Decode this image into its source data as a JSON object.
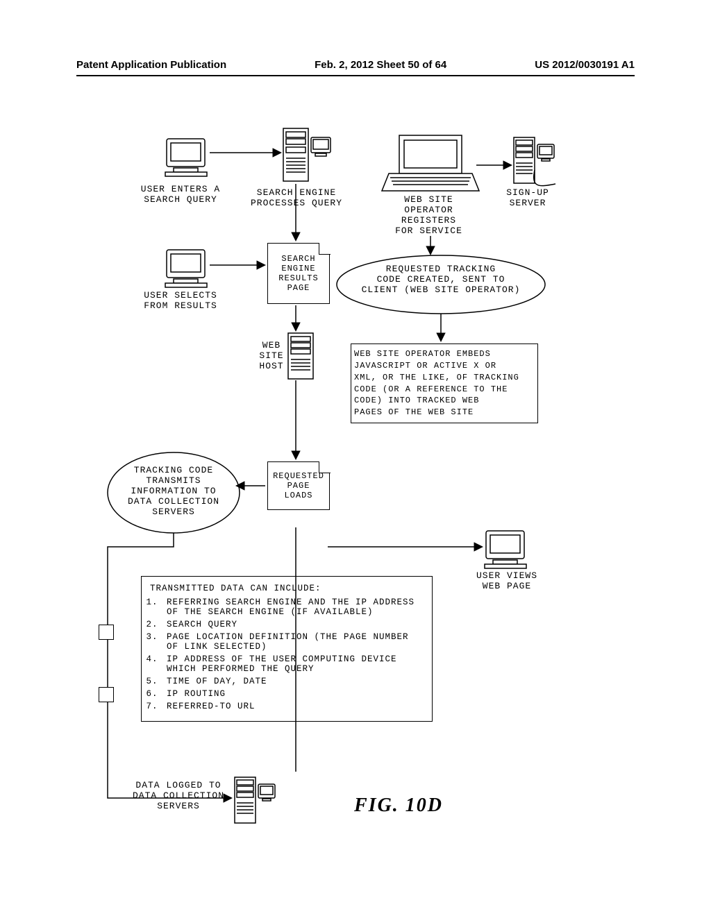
{
  "header": {
    "left": "Patent Application Publication",
    "center": "Feb. 2, 2012  Sheet 50 of 64",
    "right": "US 2012/0030191 A1"
  },
  "labels": {
    "user_enters_query": "USER ENTERS A\nSEARCH QUERY",
    "search_engine_processes": "SEARCH ENGINE\nPROCESSES QUERY",
    "website_operator_registers": "WEB SITE\nOPERATOR\nREGISTERS\nFOR SERVICE",
    "signup_server": "SIGN-UP\nSERVER",
    "user_selects_results": "USER SELECTS\nFROM RESULTS",
    "search_results_page": "SEARCH\nENGINE\nRESULTS\nPAGE",
    "tracking_code_created": "REQUESTED TRACKING\nCODE CREATED, SENT TO\nCLIENT (WEB SITE OPERATOR)",
    "website_host": "WEB\nSITE\nHOST",
    "operator_embeds": "WEB SITE OPERATOR EMBEDS\nJAVASCRIPT OR ACTIVE X OR\nXML, OR THE LIKE, OF TRACKING\nCODE (OR A REFERENCE TO THE\nCODE) INTO TRACKED WEB\nPAGES OF THE WEB SITE",
    "tracking_transmits": "TRACKING CODE\nTRANSMITS\nINFORMATION TO\nDATA COLLECTION\nSERVERS",
    "requested_page_loads": "REQUESTED\nPAGE\nLOADS",
    "user_views_page": "USER VIEWS\nWEB PAGE",
    "data_logged": "DATA LOGGED TO\nDATA COLLECTION\nSERVERS",
    "figure": "FIG.  10D"
  },
  "transmitted_list": {
    "title": "TRANSMITTED DATA CAN INCLUDE:",
    "items": [
      "REFERRING SEARCH ENGINE AND THE IP ADDRESS OF THE SEARCH ENGINE (IF AVAILABLE)",
      "SEARCH QUERY",
      "PAGE LOCATION DEFINITION (THE PAGE NUMBER OF LINK SELECTED)",
      "IP ADDRESS OF THE USER COMPUTING DEVICE WHICH PERFORMED THE QUERY",
      "TIME OF DAY, DATE",
      "IP ROUTING",
      "REFERRED-TO URL"
    ]
  }
}
